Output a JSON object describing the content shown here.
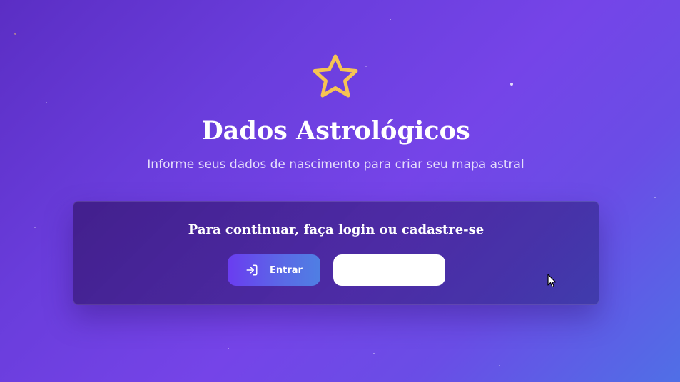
{
  "header": {
    "icon": "star-icon",
    "title": "Dados Astrológicos",
    "subtitle": "Informe seus dados de nascimento para criar seu mapa astral"
  },
  "auth_card": {
    "heading": "Para continuar, faça login ou cadastre-se",
    "login_button": {
      "icon": "log-in-icon",
      "label": "Entrar"
    },
    "signup_button": {
      "label": ""
    }
  },
  "colors": {
    "background_start": "#5b2ec4",
    "background_end": "#506fe6",
    "star_icon": "#f6c453",
    "login_button_start": "#6a3cf0",
    "login_button_end": "#4f7fe3",
    "signup_button": "#ffffff"
  }
}
